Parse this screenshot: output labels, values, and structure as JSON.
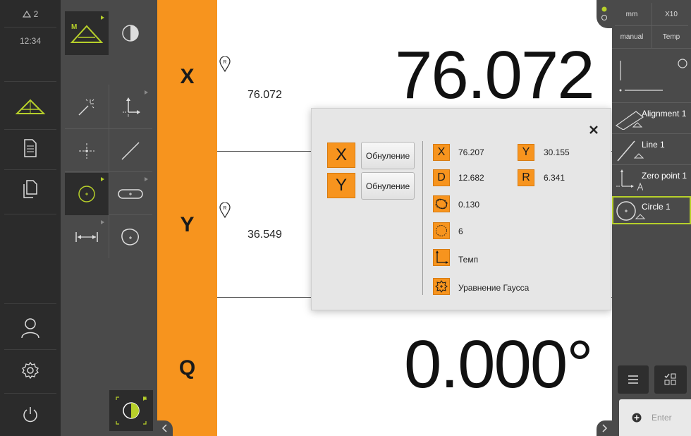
{
  "status": {
    "warning_count": "2",
    "time": "12:34"
  },
  "axes": [
    {
      "letter": "X",
      "small_value": "76.072",
      "big_value": "76.072"
    },
    {
      "letter": "Y",
      "small_value": "36.549"
    },
    {
      "letter": "Q",
      "big_value": "0.000°"
    }
  ],
  "popup": {
    "zero_labels": [
      "Обнуление",
      "Обнуление"
    ],
    "axis_x": "X",
    "axis_y": "Y",
    "values": {
      "x": {
        "label": "X",
        "value": "76.207"
      },
      "y": {
        "label": "Y",
        "value": "30.155"
      },
      "d": {
        "label": "D",
        "value": "12.682"
      },
      "r": {
        "label": "R",
        "value": "6.341"
      },
      "form": "0.130",
      "points": "6",
      "coord_system": "Темп",
      "fit_method": "Уравнение Гаусса"
    }
  },
  "right_panel": {
    "unit": "mm",
    "zoom": "X10",
    "mode": "manual",
    "temp": "Temp",
    "features": [
      "Alignment 1",
      "Line 1",
      "Zero point 1",
      "Circle 1"
    ],
    "enter_label": "Enter"
  },
  "tools": {
    "measure_letter": "M"
  },
  "colors": {
    "orange": "#f7941e",
    "accent_green": "#b7d02a",
    "dark": "#2b2b2b",
    "mid": "#4a4a4a"
  }
}
